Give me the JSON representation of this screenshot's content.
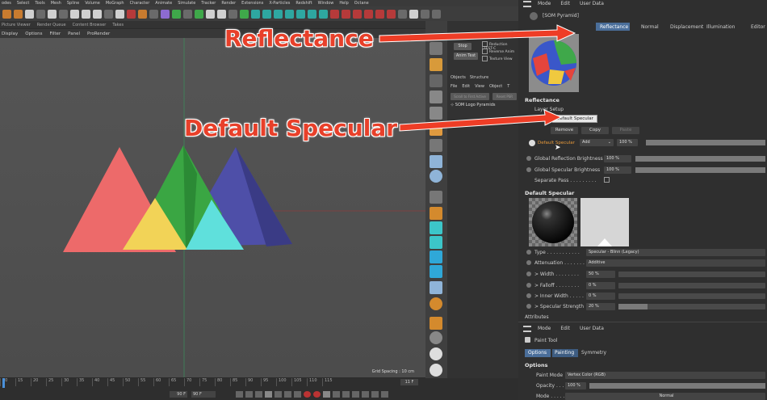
{
  "c4d": {
    "main_menu": [
      "odes",
      "Select",
      "Tools",
      "Mesh",
      "Spline",
      "Volume",
      "MoGraph",
      "Character",
      "Animate",
      "Simulate",
      "Tracker",
      "Render",
      "Extensions",
      "X-Particles",
      "Redshift",
      "Window",
      "Help",
      "Octane"
    ],
    "panel_tabs": [
      "Picture Viewer",
      "Render Queue",
      "Content Browser",
      "Takes"
    ],
    "viewport_menu": [
      "Display",
      "Options",
      "Filter",
      "Panel",
      "ProRender"
    ],
    "grid_spacing": "Grid Spacing : 10 cm",
    "mid_panel": {
      "stop": "Stop",
      "anim_test": "Anim Test",
      "checkboxes": [
        "Reduction (TEST-C",
        "Reverse Anim",
        "Texture View"
      ],
      "tabs": [
        "Objects",
        "Structure"
      ],
      "menu": [
        "File",
        "Edit",
        "View",
        "Object",
        "T"
      ],
      "scroll_btn": "Scroll to First Active",
      "reset_btn": "Reset PSR",
      "object_name": "SOM Logo Pyramids"
    },
    "timeline": {
      "ticks": [
        "10",
        "15",
        "20",
        "25",
        "30",
        "35",
        "40",
        "45",
        "50",
        "55",
        "60",
        "65",
        "70",
        "75",
        "80",
        "85",
        "90",
        "95",
        "100",
        "105",
        "110",
        "115"
      ],
      "frame_left": "90 F",
      "frame_right": "90 F",
      "current": "11 F"
    }
  },
  "callouts": {
    "reflectance": "Reflectance",
    "default_specular": "Default Specular"
  },
  "attributes": {
    "top_menu": [
      "Mode",
      "Edit",
      "User Data"
    ],
    "material_name": "[SOM Pyramid]",
    "tabs": [
      "Reflectance",
      "Normal",
      "Displacement",
      "Illumination",
      "Editor"
    ],
    "section_reflectance": "Reflectance",
    "layer_setup": "Layer Setup",
    "tooltip": "Default Specular",
    "buttons": [
      "Remove",
      "Copy",
      "Paste"
    ],
    "layer_name": "Default Specular",
    "add_mode": "Add",
    "layer_opacity": "100 %",
    "global_reflection_label": "Global Reflection Brightness",
    "global_reflection_value": "100 %",
    "global_specular_label": "Global Specular Brightness",
    "global_specular_value": "100 %",
    "separate_pass": "Separate Pass . . . . . . . . .",
    "section_default_specular": "Default Specular",
    "type_label": "Type . . . . . . . . . . .",
    "type_value": "Specular - Blinn (Legacy)",
    "attenuation_label": "Attenuation . . . . . . .",
    "attenuation_value": "Additive",
    "width_label": "> Width . . . . . . . .",
    "width_value": "50 %",
    "falloff_label": "> Falloff . . . . . . . .",
    "falloff_value": "0 %",
    "inner_width_label": "> Inner Width . . . . .",
    "inner_width_value": "0 %",
    "specular_strength_label": "> Specular Strength",
    "specular_strength_value": "20 %",
    "specular_strength_level": 0.2
  },
  "attributes2": {
    "title": "Attributes",
    "menu": [
      "Mode",
      "Edit",
      "User Data"
    ],
    "tool_name": "Paint Tool",
    "tabs": [
      "Options",
      "Painting",
      "Symmetry"
    ],
    "section": "Options",
    "paint_mode_label": "Paint Mode",
    "paint_mode_value": "Vertex Color (RGB)",
    "opacity_label": "Opacity . . .",
    "opacity_value": "100 %",
    "mode_label": "Mode . . . . . . .",
    "mode_value": "Normal"
  }
}
